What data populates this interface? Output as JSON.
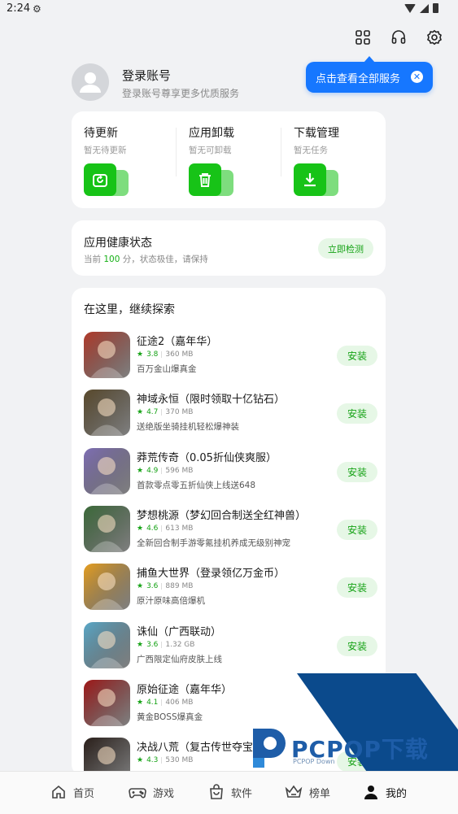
{
  "status_bar": {
    "time": "2:24"
  },
  "tooltip": {
    "text": "点击查看全部服务"
  },
  "profile": {
    "title": "登录账号",
    "subtitle": "登录账号尊享更多优质服务"
  },
  "manage": [
    {
      "title": "待更新",
      "subtitle": "暂无待更新",
      "icon": "update-icon"
    },
    {
      "title": "应用卸载",
      "subtitle": "暂无可卸载",
      "icon": "trash-icon"
    },
    {
      "title": "下载管理",
      "subtitle": "暂无任务",
      "icon": "download-icon"
    }
  ],
  "health": {
    "title": "应用健康状态",
    "sub_prefix": "当前",
    "score": "100",
    "sub_suffix": "分，状态极佳，请保持",
    "button": "立即检测"
  },
  "explore": {
    "title": "在这里，继续探索",
    "install_label": "安装",
    "apps": [
      {
        "name": "征途2（嘉年华）",
        "rating": "3.8",
        "size": "360 MB",
        "desc": "百万金山爆真金",
        "color": "#b23a2a"
      },
      {
        "name": "神域永恒（限时领取十亿钻石）",
        "rating": "4.7",
        "size": "370 MB",
        "desc": "送绝版坐骑挂机轻松爆神装",
        "color": "#5a4a2c"
      },
      {
        "name": "莽荒传奇（0.05折仙侠爽服）",
        "rating": "4.9",
        "size": "596 MB",
        "desc": "首款零点零五折仙侠上线送648",
        "color": "#7f6fb5"
      },
      {
        "name": "梦想桃源（梦幻回合制送全红神兽）",
        "rating": "4.6",
        "size": "613 MB",
        "desc": "全新回合制手游零氪挂机养成无级别神宠",
        "color": "#3c6b3a"
      },
      {
        "name": "捕鱼大世界（登录领亿万金币）",
        "rating": "3.6",
        "size": "889 MB",
        "desc": "原汁原味高倍爆机",
        "color": "#e8a020"
      },
      {
        "name": "诛仙（广西联动）",
        "rating": "3.6",
        "size": "1.32 GB",
        "desc": "广西限定仙府皮肤上线",
        "color": "#5aa9c9"
      },
      {
        "name": "原始征途（嘉年华）",
        "rating": "4.1",
        "size": "406 MB",
        "desc": "黄金BOSS爆真金",
        "color": "#a01818"
      },
      {
        "name": "决战八荒（复古传世夺宝打金）",
        "rating": "4.3",
        "size": "530 MB",
        "desc": "",
        "color": "#2a1f1a"
      }
    ]
  },
  "nav": [
    {
      "label": "首页",
      "icon": "home-icon"
    },
    {
      "label": "游戏",
      "icon": "gamepad-icon"
    },
    {
      "label": "软件",
      "icon": "bag-icon"
    },
    {
      "label": "榜单",
      "icon": "crown-icon"
    },
    {
      "label": "我的",
      "icon": "person-icon"
    }
  ],
  "watermark": {
    "brand": "PCPOP下载",
    "small": "PCPOP Down"
  },
  "colors": {
    "accent_green": "#17c317",
    "tooltip_blue": "#1677ff"
  }
}
